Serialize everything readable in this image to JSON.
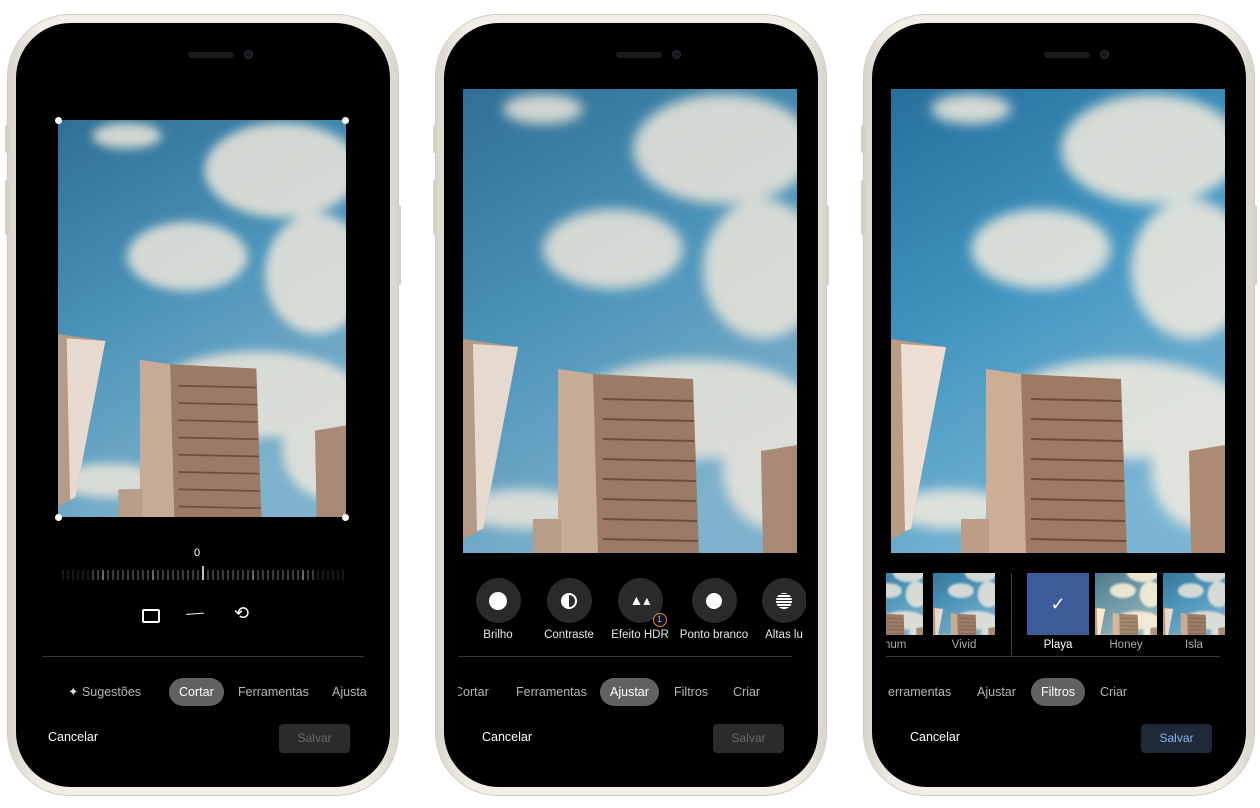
{
  "phones": [
    {
      "mode": "crop",
      "rotation_value": "0",
      "crop_tools": [
        "aspect-ratio-icon",
        "auto-crop-wand-icon",
        "rotate-icon"
      ],
      "tabs": [
        {
          "label": "Sugestões",
          "icon": "sparkle-icon"
        },
        {
          "label": "Cortar",
          "active": true
        },
        {
          "label": "Ferramentas"
        },
        {
          "label": "Ajusta"
        }
      ],
      "cancel": "Cancelar",
      "save": "Salvar",
      "save_enabled": false
    },
    {
      "mode": "adjust",
      "tools": [
        {
          "label": "Brilho",
          "icon": "brightness-icon"
        },
        {
          "label": "Contraste",
          "icon": "contrast-icon"
        },
        {
          "label": "Efeito HDR",
          "icon": "hdr-mountain-icon",
          "badge": "1"
        },
        {
          "label": "Ponto branco",
          "icon": "white-point-icon"
        },
        {
          "label": "Altas lu",
          "icon": "highlights-icon"
        }
      ],
      "tabs": [
        {
          "label": "Cortar"
        },
        {
          "label": "Ferramentas"
        },
        {
          "label": "Ajustar",
          "active": true
        },
        {
          "label": "Filtros"
        },
        {
          "label": "Criar"
        }
      ],
      "cancel": "Cancelar",
      "save": "Salvar",
      "save_enabled": false
    },
    {
      "mode": "filters",
      "filters": [
        {
          "label": "nhum"
        },
        {
          "label": "Vivid"
        },
        {
          "label": "Playa",
          "selected": true
        },
        {
          "label": "Honey"
        },
        {
          "label": "Isla"
        }
      ],
      "tabs": [
        {
          "label": "erramentas"
        },
        {
          "label": "Ajustar"
        },
        {
          "label": "Filtros",
          "active": true
        },
        {
          "label": "Criar"
        }
      ],
      "cancel": "Cancelar",
      "save": "Salvar",
      "save_enabled": true
    }
  ],
  "colors": {
    "selected_filter": "#3d5a99",
    "save_active_text": "#8ab4f8",
    "tab_active_bg": "#5f6163"
  }
}
